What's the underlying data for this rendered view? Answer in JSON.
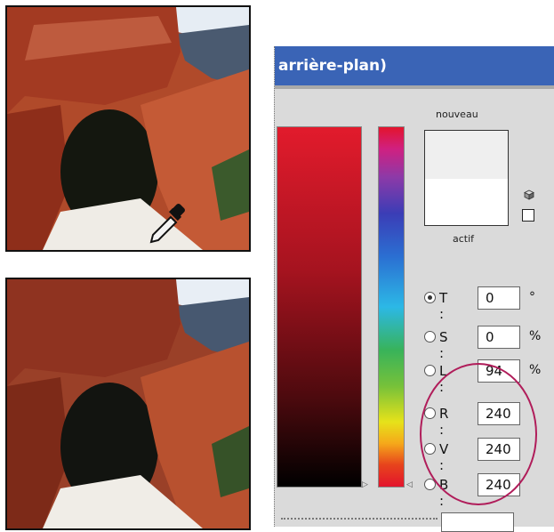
{
  "dialog": {
    "title": "arrière-plan)",
    "label_new": "nouveau",
    "label_current": "actif",
    "swatch_new_color": "#efefef",
    "swatch_current_color": "#ffffff"
  },
  "color_values": [
    {
      "label": "T :",
      "value": "0",
      "unit": "°",
      "checked": true
    },
    {
      "label": "S :",
      "value": "0",
      "unit": "%",
      "checked": false
    },
    {
      "label": "L :",
      "value": "94",
      "unit": "%",
      "checked": false
    },
    {
      "label": "R :",
      "value": "240",
      "unit": "",
      "checked": false
    },
    {
      "label": "V :",
      "value": "240",
      "unit": "",
      "checked": false
    },
    {
      "label": "B :",
      "value": "240",
      "unit": "",
      "checked": false
    }
  ],
  "icons": {
    "eyedropper": "eyedropper-icon",
    "cube": "web-color-cube-icon",
    "slider_arrow": "slider-triangle-icon"
  },
  "colors": {
    "titlebar": "#3a64b6",
    "highlight": "#b01d5a",
    "field_top": "#e21b2c"
  }
}
